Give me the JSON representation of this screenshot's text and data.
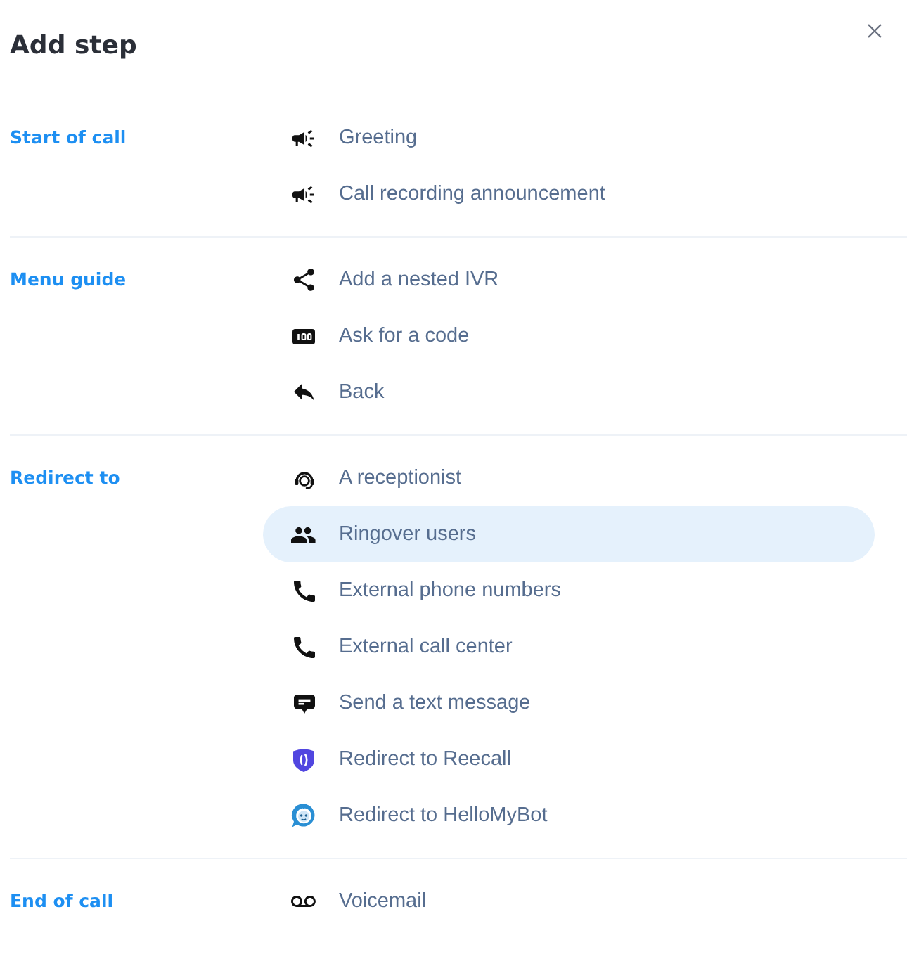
{
  "title": "Add step",
  "sections": [
    {
      "label": "Start of call",
      "items": [
        {
          "kind": "megaphone",
          "label": "Greeting",
          "selected": false
        },
        {
          "kind": "megaphone",
          "label": "Call recording announcement",
          "selected": false
        }
      ]
    },
    {
      "label": "Menu guide",
      "items": [
        {
          "kind": "share",
          "label": "Add a nested IVR",
          "selected": false
        },
        {
          "kind": "numpad",
          "label": "Ask for a code",
          "selected": false
        },
        {
          "kind": "reply",
          "label": "Back",
          "selected": false
        }
      ]
    },
    {
      "label": "Redirect to",
      "items": [
        {
          "kind": "headset",
          "label": "A receptionist",
          "selected": false
        },
        {
          "kind": "people",
          "label": "Ringover users",
          "selected": true
        },
        {
          "kind": "phone",
          "label": "External phone numbers",
          "selected": false
        },
        {
          "kind": "phone",
          "label": "External call center",
          "selected": false
        },
        {
          "kind": "chat",
          "label": "Send a text message",
          "selected": false
        },
        {
          "kind": "shield",
          "label": "Redirect to Reecall",
          "selected": false
        },
        {
          "kind": "robot",
          "label": "Redirect to HelloMyBot",
          "selected": false
        }
      ]
    },
    {
      "label": "End of call",
      "items": [
        {
          "kind": "voicemail",
          "label": "Voicemail",
          "selected": false
        }
      ]
    }
  ]
}
